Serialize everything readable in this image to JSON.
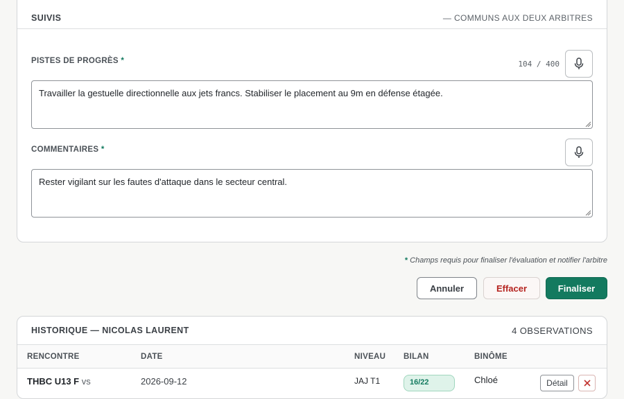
{
  "suivis": {
    "title": "SUIVIS",
    "note": "— COMMUNS AUX DEUX ARBITRES",
    "pistes": {
      "label": "PISTES DE PROGRÈS",
      "required_mark": "*",
      "counter": "104 / 400",
      "value": "Travailler la gestuelle directionnelle aux jets francs. Stabiliser le placement au 9m en défense étagée.",
      "mic_icon": "microphone-icon"
    },
    "commentaires": {
      "label": "COMMENTAIRES",
      "required_mark": "*",
      "value": "Rester vigilant sur les fautes d'attaque dans le secteur central.",
      "mic_icon": "microphone-icon"
    }
  },
  "required_note": {
    "mark": "*",
    "text": " Champs requis pour finaliser l'évaluation et notifier l'arbitre"
  },
  "actions": {
    "cancel": "Annuler",
    "clear": "Effacer",
    "finalize": "Finaliser"
  },
  "history": {
    "title": "HISTORIQUE — NICOLAS LAURENT",
    "count": "4 OBSERVATIONS",
    "columns": [
      "RENCONTRE",
      "DATE",
      "NIVEAU",
      "BILAN",
      "BINÔME"
    ],
    "rows": [
      {
        "team": "THBC U13 F",
        "vs": "vs",
        "date": "2026-09-12",
        "level": "JAJ T1",
        "score": "16/22",
        "partner": "Chloé",
        "detail": "Détail"
      }
    ]
  },
  "colors": {
    "accent": "#137a5f",
    "danger": "#b5231f",
    "border": "#d4d6d8"
  }
}
